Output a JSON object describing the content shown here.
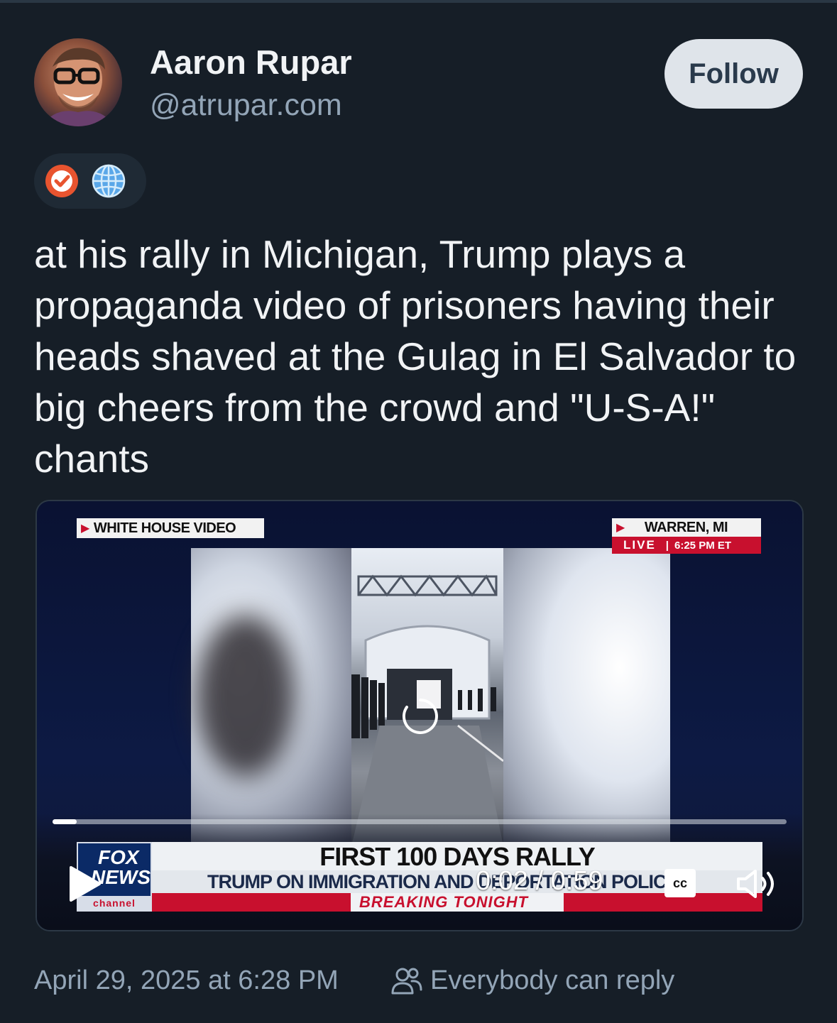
{
  "author": {
    "name": "Aaron Rupar",
    "handle": "@atrupar.com",
    "avatar_icon": "avatar-photo"
  },
  "header": {
    "follow_label": "Follow"
  },
  "badges": [
    {
      "icon": "verified-check-icon",
      "color": "#e8542f"
    },
    {
      "icon": "globe-icon",
      "color": "#5aa7e8"
    }
  ],
  "post": {
    "text": "at his rally in Michigan, Trump plays a propaganda video of prisoners having their heads shaved at the Gulag in El Salvador to big cheers from the crowd and \"U-S-A!\" chants"
  },
  "video": {
    "tag_source": "WHITE HOUSE VIDEO",
    "tag_location": "WARREN, MI",
    "tag_live": "LIVE",
    "tag_time": "6:25 PM ET",
    "logo_fox": "FOX",
    "logo_news": "NEWS",
    "logo_channel": "channel",
    "banner_title": "FIRST 100 DAYS RALLY",
    "banner_subtitle": "TRUMP ON IMMIGRATION AND DEPORTATION POLICIES",
    "banner_breaking": "BREAKING TONIGHT",
    "time_display": "0:02 / 0:59",
    "progress_fraction": 0.033,
    "cc_label": "cc"
  },
  "footer": {
    "timestamp": "April 29, 2025 at 6:28 PM",
    "reply_setting": "Everybody can reply"
  }
}
